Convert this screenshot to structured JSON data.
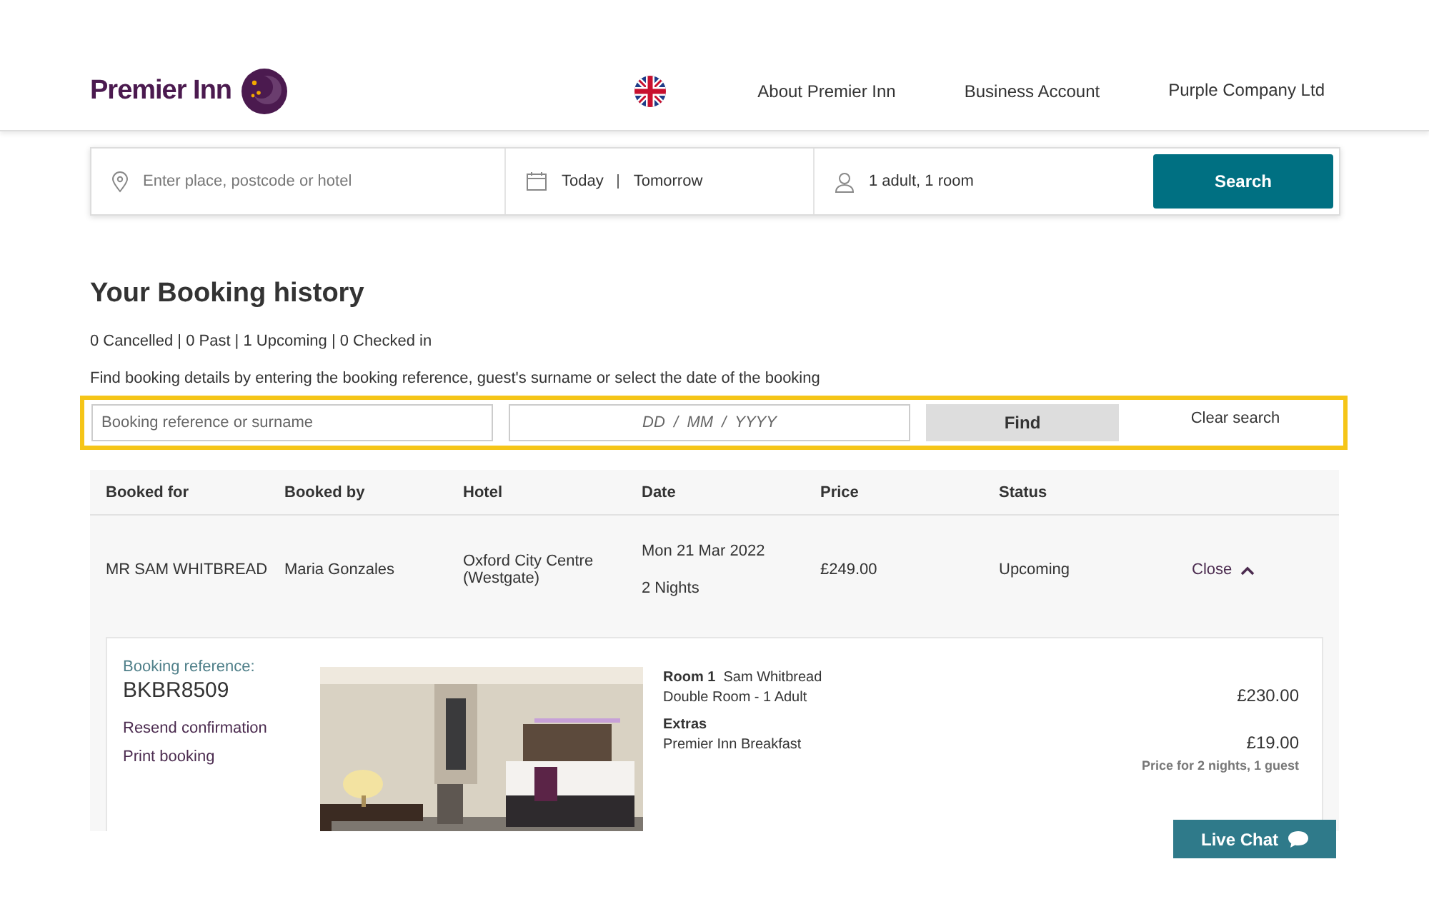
{
  "header": {
    "logo": "Premier Inn",
    "nav": [
      "About Premier Inn",
      "Business Account",
      "Purple Company Ltd"
    ]
  },
  "search_bar": {
    "location_placeholder": "Enter place, postcode or hotel",
    "check_in": "Today",
    "check_out": "Tomorrow",
    "guests": "1 adult, 1 room",
    "button": "Search"
  },
  "history": {
    "title": "Your Booking history",
    "summary": "0 Cancelled | 0 Past | 1 Upcoming | 0 Checked in",
    "instructions": "Find booking details by entering the booking reference, guest's surname or select the date of the booking"
  },
  "filter": {
    "reference_placeholder": "Booking reference or surname",
    "date_placeholder": "DD  /  MM  /  YYYY",
    "find": "Find",
    "clear": "Clear search"
  },
  "table": {
    "columns": [
      "Booked for",
      "Booked by",
      "Hotel",
      "Date",
      "Price",
      "Status"
    ],
    "rows": [
      {
        "booked_for": "MR SAM WHITBREAD",
        "booked_by": "Maria Gonzales",
        "hotel": "Oxford City Centre (Westgate)",
        "date": "Mon 21 Mar 2022",
        "nights": "2 Nights",
        "price": "£249.00",
        "status": "Upcoming",
        "action": "Close",
        "expanded": true,
        "details": {
          "reference_label": "Booking reference:",
          "reference": "BKBR8509",
          "links": [
            "Resend confirmation",
            "Print booking"
          ],
          "room_label": "Room 1",
          "room_guest": "Sam Whitbread",
          "room_type": "Double Room - 1 Adult",
          "room_price": "£230.00",
          "extras_label": "Extras",
          "extras_item": "Premier Inn Breakfast",
          "extras_price": "£19.00",
          "price_note": "Price for 2 nights, 1 guest"
        }
      }
    ]
  },
  "live_chat": "Live Chat"
}
